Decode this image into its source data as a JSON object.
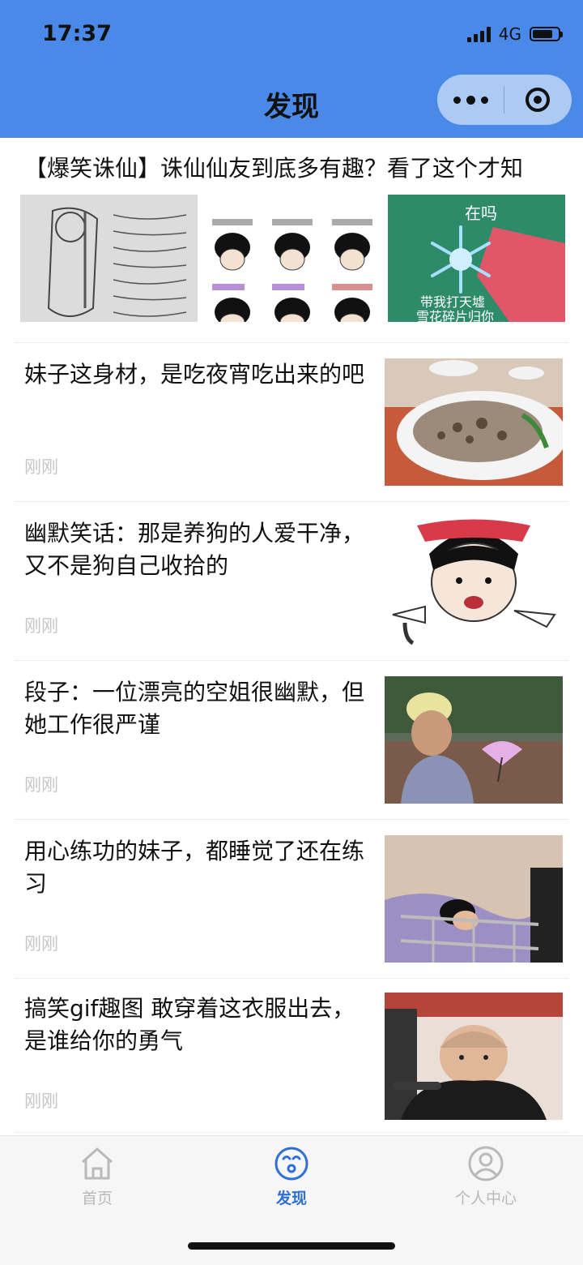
{
  "status_bar": {
    "time": "17:37",
    "network": "4G"
  },
  "nav": {
    "title": "发现"
  },
  "multi_article": {
    "title": "【爆笑诛仙】诛仙仙友到底多有趣？看了这个才知",
    "image_texts": [
      "在吗",
      "带我打天墟",
      "雪花碎片归你"
    ]
  },
  "articles": [
    {
      "title": "妹子这身材，是吃夜宵吃出来的吧",
      "time": "刚刚"
    },
    {
      "title": "幽默笑话：那是养狗的人爱干净，又不是狗自己收拾的",
      "time": "刚刚"
    },
    {
      "title": "段子：一位漂亮的空姐很幽默，但她工作很严谨",
      "time": "刚刚"
    },
    {
      "title": "用心练功的妹子，都睡觉了还在练习",
      "time": "刚刚"
    },
    {
      "title": "搞笑gif趣图 敢穿着这衣服出去，是谁给你的勇气",
      "time": "刚刚"
    }
  ],
  "tabbar": {
    "items": [
      {
        "label": "首页",
        "icon": "home-icon",
        "active": false
      },
      {
        "label": "发现",
        "icon": "discover-icon",
        "active": true
      },
      {
        "label": "个人中心",
        "icon": "profile-icon",
        "active": false
      }
    ],
    "active_color": "#2f6fd6",
    "inactive_color": "#b9b9b9"
  },
  "colors": {
    "header": "#4a89e8",
    "tabbar_bg": "#f6f6f6"
  }
}
